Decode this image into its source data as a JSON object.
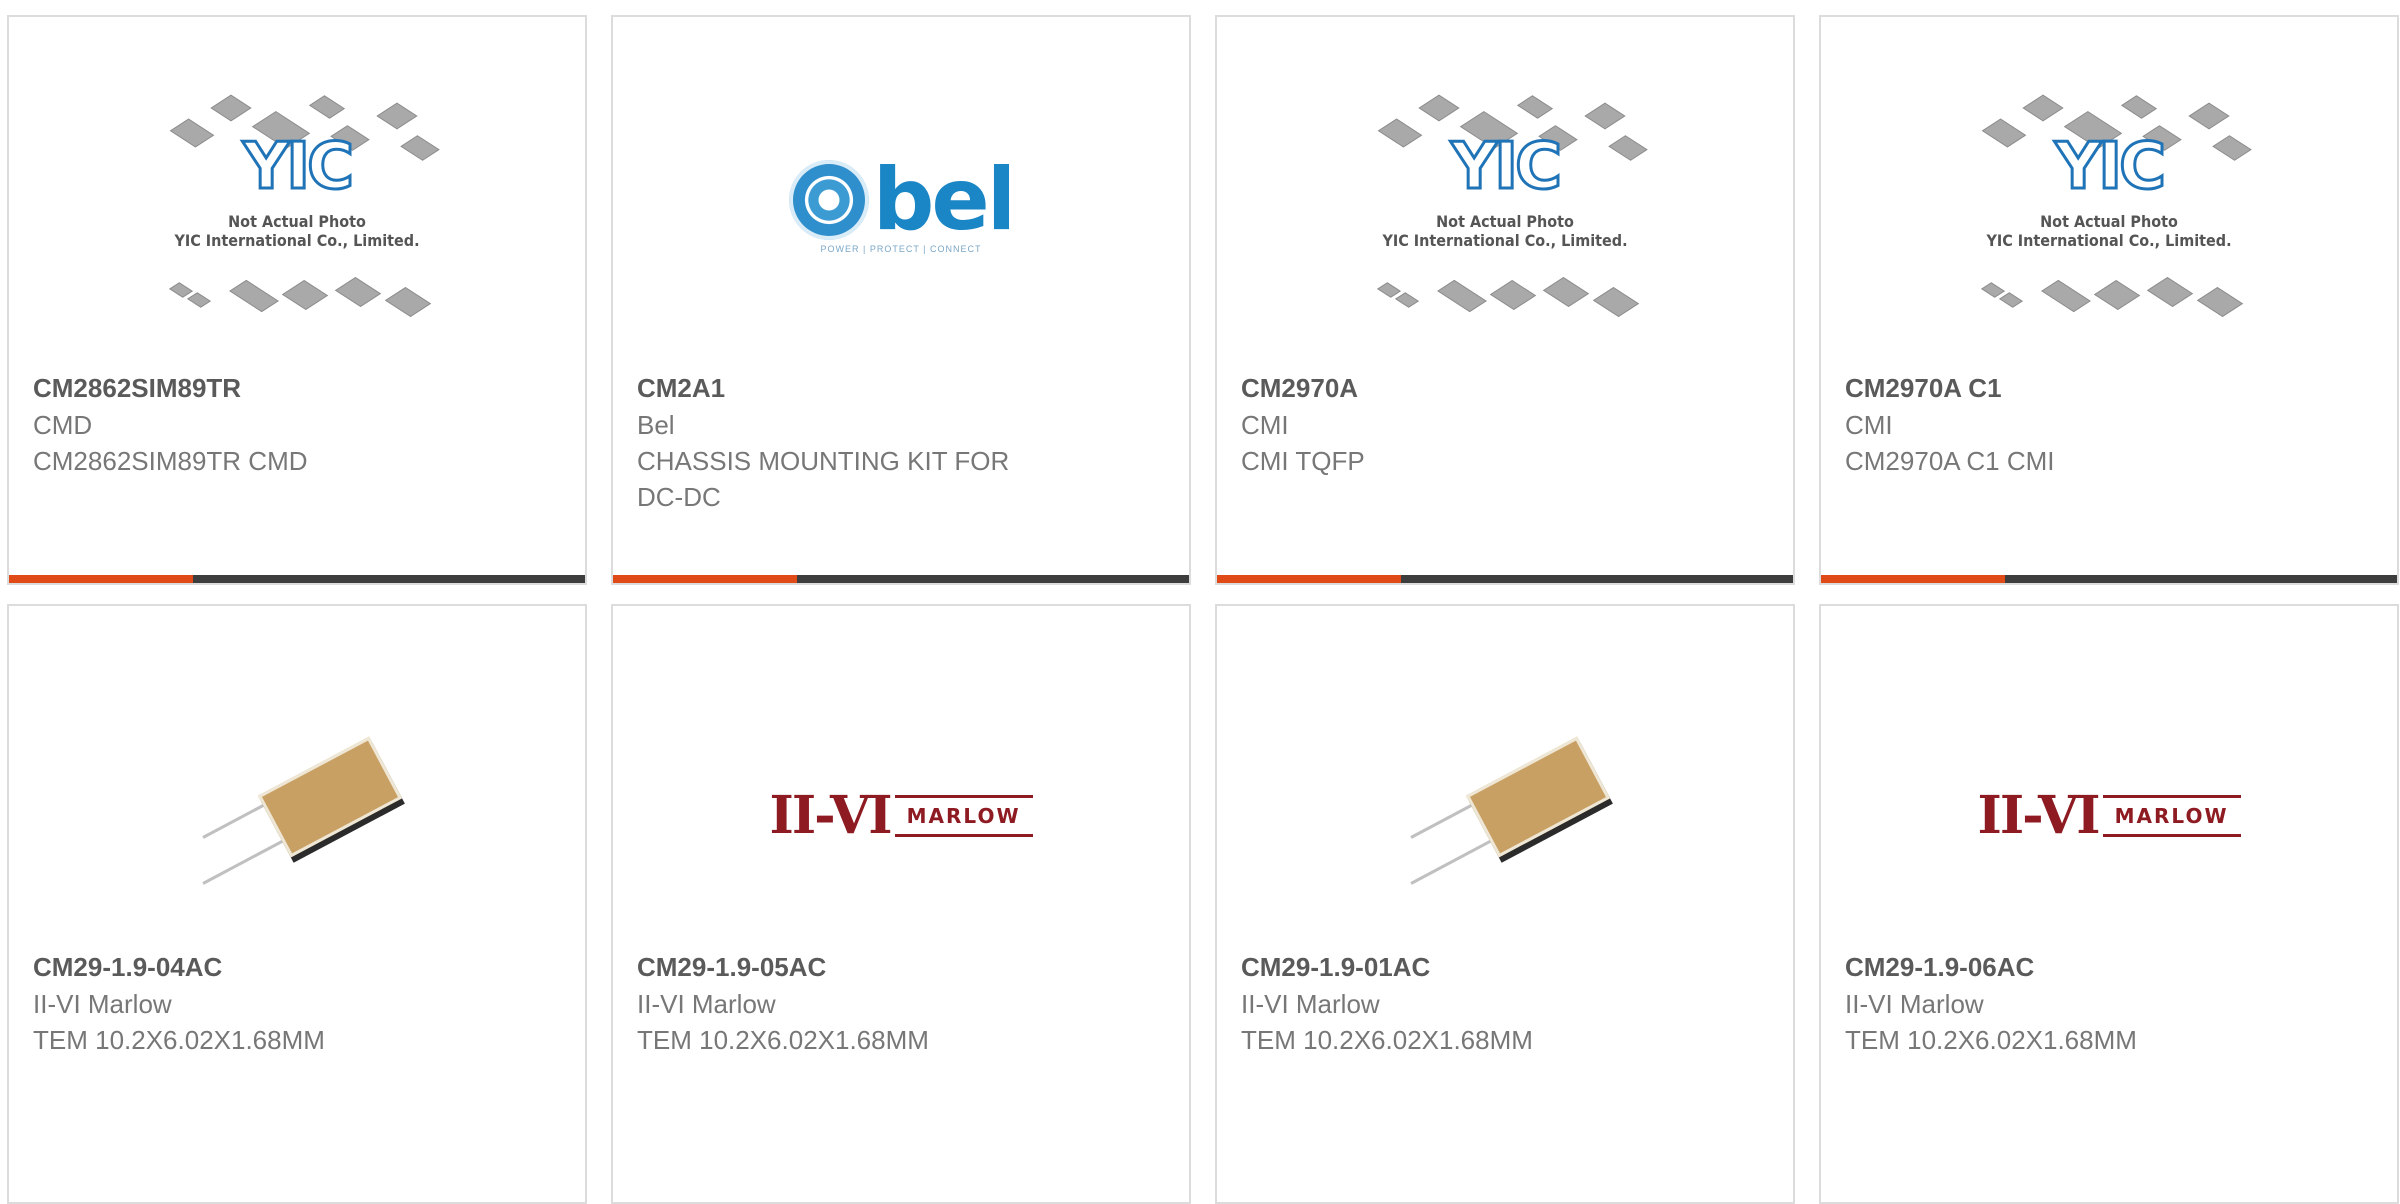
{
  "products": [
    {
      "part_number": "CM2862SIM89TR",
      "manufacturer": "CMD",
      "description": "CM2862SIM89TR CMD",
      "image": "yic-placeholder",
      "image_note_line1": "Not Actual Photo",
      "image_note_line2": "YIC International Co., Limited.",
      "image_logo": "YIC"
    },
    {
      "part_number": "CM2A1",
      "manufacturer": "Bel",
      "description": "CHASSIS MOUNTING KIT FOR DC-DC",
      "image": "bel-logo",
      "image_logo": "bel",
      "image_tagline": "POWER | PROTECT | CONNECT"
    },
    {
      "part_number": "CM2970A",
      "manufacturer": "CMI",
      "description": "CMI TQFP",
      "image": "yic-placeholder",
      "image_note_line1": "Not Actual Photo",
      "image_note_line2": "YIC International Co., Limited.",
      "image_logo": "YIC"
    },
    {
      "part_number": "CM2970A C1",
      "manufacturer": "CMI",
      "description": "CM2970A C1 CMI",
      "image": "yic-placeholder",
      "image_note_line1": "Not Actual Photo",
      "image_note_line2": "YIC International Co., Limited.",
      "image_logo": "YIC"
    },
    {
      "part_number": "CM29-1.9-04AC",
      "manufacturer": "II-VI Marlow",
      "description": "TEM 10.2X6.02X1.68MM",
      "image": "tem-module-photo"
    },
    {
      "part_number": "CM29-1.9-05AC",
      "manufacturer": "II-VI Marlow",
      "description": "TEM 10.2X6.02X1.68MM",
      "image": "ii-vi-marlow-logo",
      "image_logo_left": "II-VI",
      "image_logo_right": "MARLOW"
    },
    {
      "part_number": "CM29-1.9-01AC",
      "manufacturer": "II-VI Marlow",
      "description": "TEM 10.2X6.02X1.68MM",
      "image": "tem-module-photo"
    },
    {
      "part_number": "CM29-1.9-06AC",
      "manufacturer": "II-VI Marlow",
      "description": "TEM 10.2X6.02X1.68MM",
      "image": "ii-vi-marlow-logo",
      "image_logo_left": "II-VI",
      "image_logo_right": "MARLOW"
    }
  ],
  "colors": {
    "accent": "#e04a17",
    "bar": "#3d3d3d",
    "border": "#dcdcdc",
    "part_number_text": "#5a5a5a",
    "secondary_text": "#777777"
  }
}
